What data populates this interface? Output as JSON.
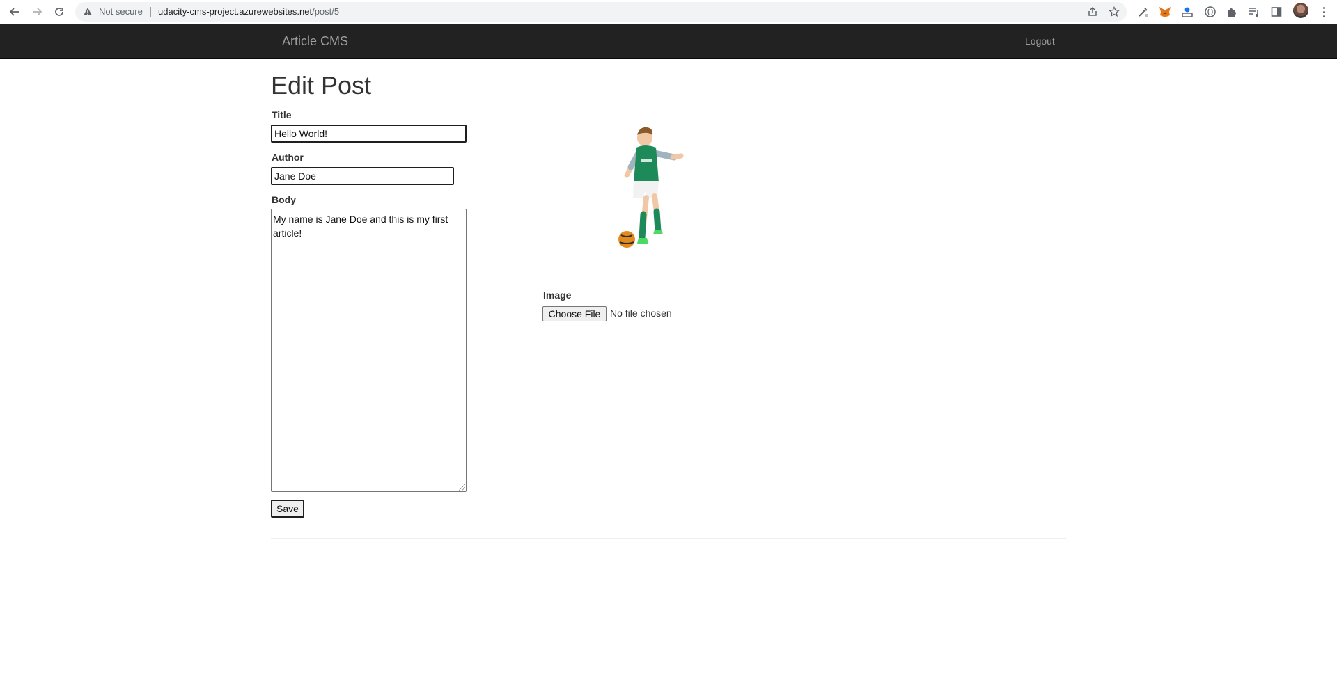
{
  "browser": {
    "security_label": "Not secure",
    "url_host": "udacity-cms-project.azurewebsites.net",
    "url_path": "/post/5"
  },
  "navbar": {
    "brand": "Article CMS",
    "logout_label": "Logout"
  },
  "page": {
    "title": "Edit Post"
  },
  "form": {
    "title_label": "Title",
    "title_value": "Hello World!",
    "author_label": "Author",
    "author_value": "Jane Doe",
    "body_label": "Body",
    "body_value": "My name is Jane Doe and this is my first article!",
    "save_label": "Save",
    "image_label": "Image",
    "file_button_label": "Choose File",
    "file_status": "No file chosen"
  },
  "image": {
    "subject": "child-soccer-player"
  },
  "colors": {
    "navbar_bg": "#222222",
    "navbar_text": "#9d9d9d",
    "jersey_green": "#1e8a5a"
  }
}
